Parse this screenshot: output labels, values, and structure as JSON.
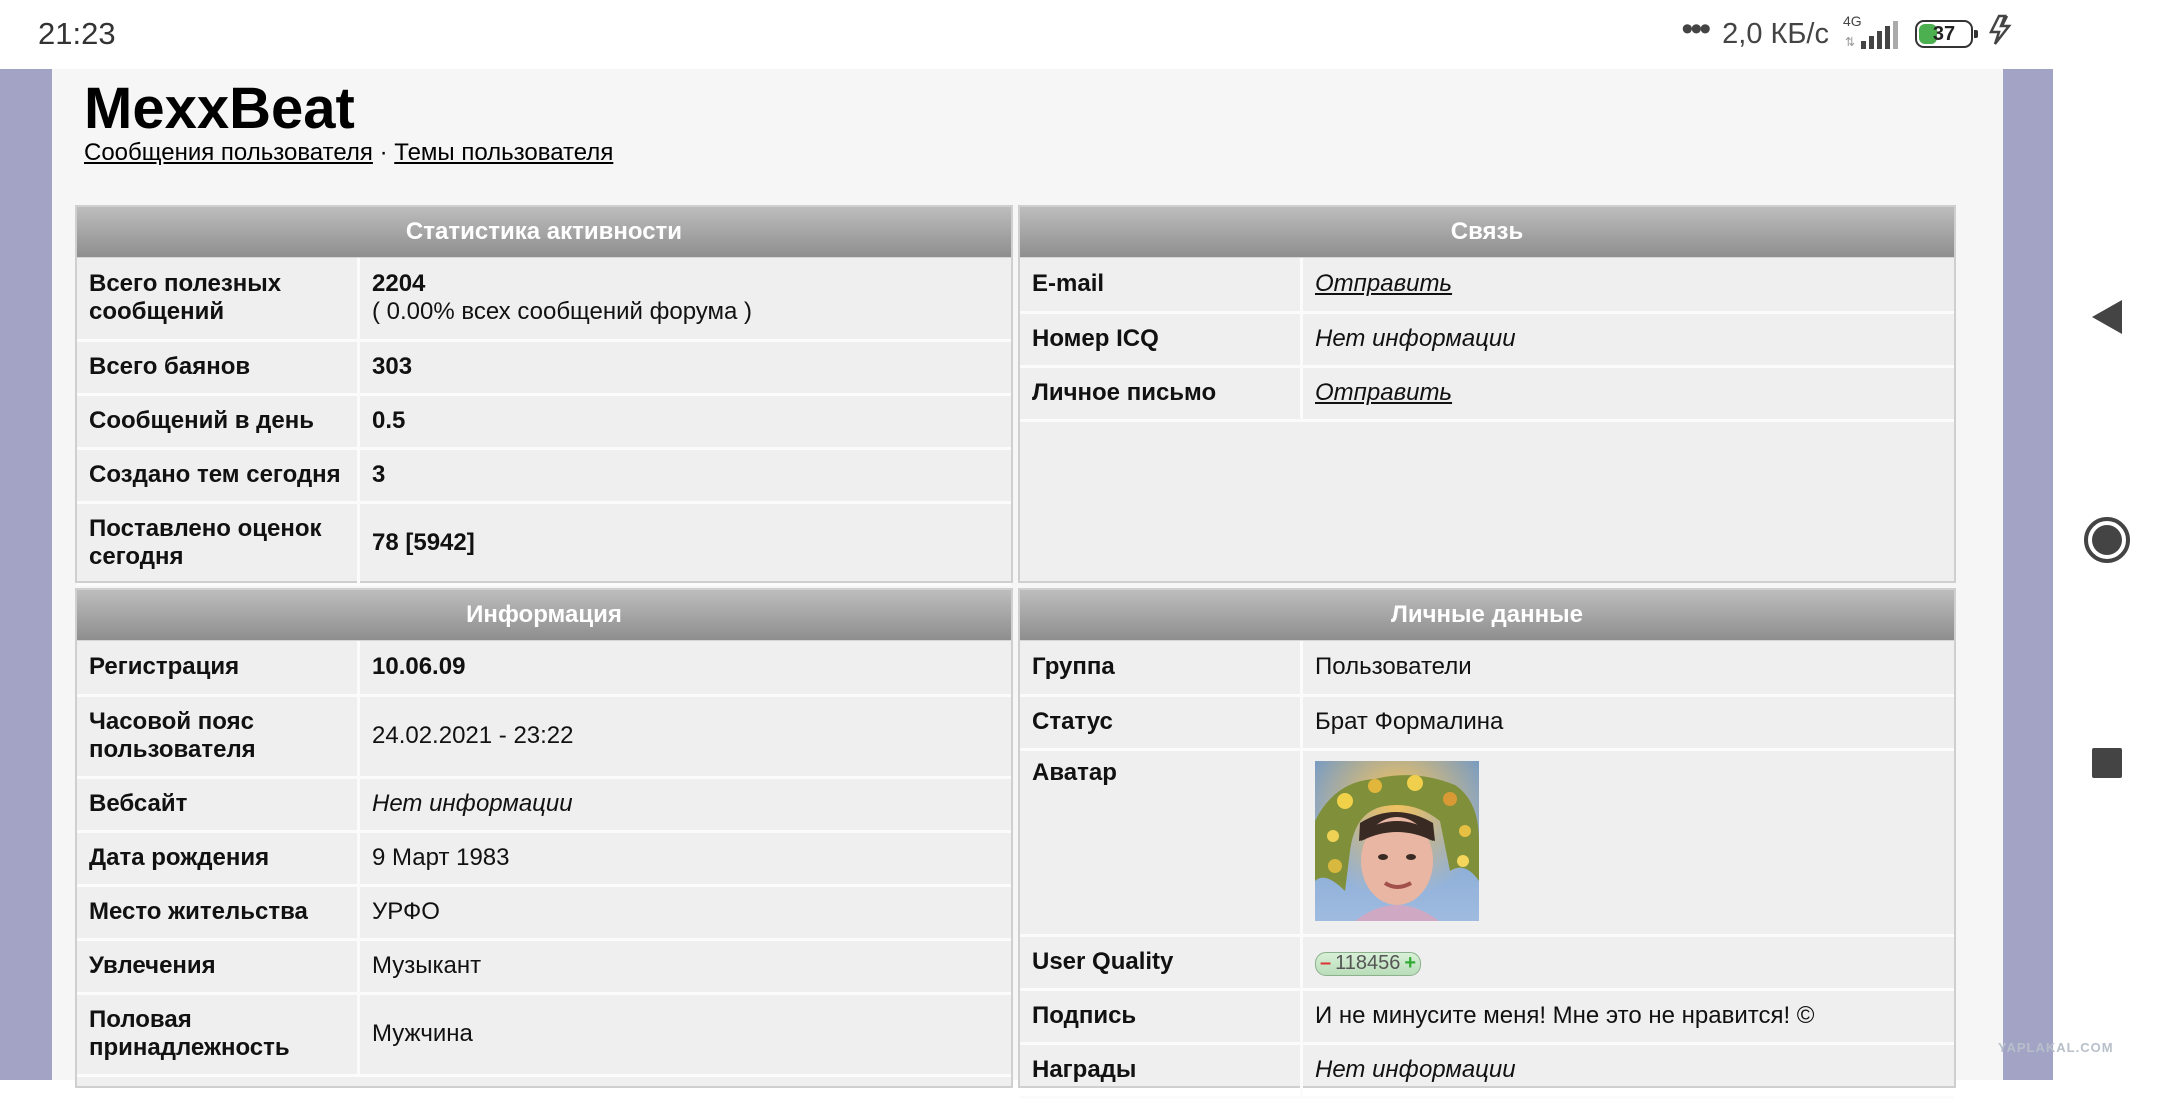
{
  "status_bar": {
    "time": "21:23",
    "dots": "•••",
    "speed": "2,0 КБ/с",
    "network": "4G",
    "battery": "37",
    "battery_level_percent": 37
  },
  "profile": {
    "username": "MexxBeat",
    "links": {
      "messages": "Сообщения пользователя",
      "separator": "·",
      "topics": "Темы пользователя"
    }
  },
  "activity": {
    "title": "Статистика активности",
    "rows": [
      {
        "label": "Всего полезных сообщений",
        "value": "2204",
        "sub": "( 0.00% всех сообщений форума )"
      },
      {
        "label": "Всего баянов",
        "value": "303"
      },
      {
        "label": "Сообщений в день",
        "value": "0.5"
      },
      {
        "label": "Создано тем сегодня",
        "value": "3"
      },
      {
        "label": "Поставлено оценок сегодня",
        "value": "78 [5942]"
      }
    ]
  },
  "contact": {
    "title": "Связь",
    "rows": [
      {
        "label": "E-mail",
        "value": "Отправить"
      },
      {
        "label": "Номер ICQ",
        "value": "Нет информации"
      },
      {
        "label": "Личное письмо",
        "value": "Отправить"
      }
    ]
  },
  "info": {
    "title": "Информация",
    "rows": [
      {
        "label": "Регистрация",
        "value": "10.06.09"
      },
      {
        "label": "Часовой пояс пользователя",
        "value": "24.02.2021 - 23:22"
      },
      {
        "label": "Вебсайт",
        "value": "Нет информации"
      },
      {
        "label": "Дата рождения",
        "value": "9 Март 1983"
      },
      {
        "label": "Место жительства",
        "value": "УРФО"
      },
      {
        "label": "Увлечения",
        "value": "Музыкант"
      },
      {
        "label": "Половая принадлежность",
        "value": "Мужчина"
      }
    ]
  },
  "personal": {
    "title": "Личные данные",
    "rows": [
      {
        "label": "Группа",
        "value": "Пользователи"
      },
      {
        "label": "Статус",
        "value": "Брат Формалина"
      },
      {
        "label": "Аватар"
      },
      {
        "label": "User Quality",
        "value": "118456",
        "minus": "–",
        "plus": "+"
      },
      {
        "label": "Подпись",
        "value": "И не минусите меня! Мне это не нравится! ©"
      },
      {
        "label": "Награды",
        "value": "Нет информации"
      }
    ]
  },
  "watermark": "YAPLAKAL.COM",
  "colors": {
    "side_band": "#a3a3c6",
    "panel_header_top": "#bdbdbd",
    "panel_header_bottom": "#8e8e8e",
    "panel_body": "#efefef",
    "quality_badge": "#c8e6c8"
  },
  "icons": {
    "back": "back-triangle-icon",
    "home": "home-circle-icon",
    "recents": "recents-square-icon",
    "charging": "lightning-icon"
  }
}
